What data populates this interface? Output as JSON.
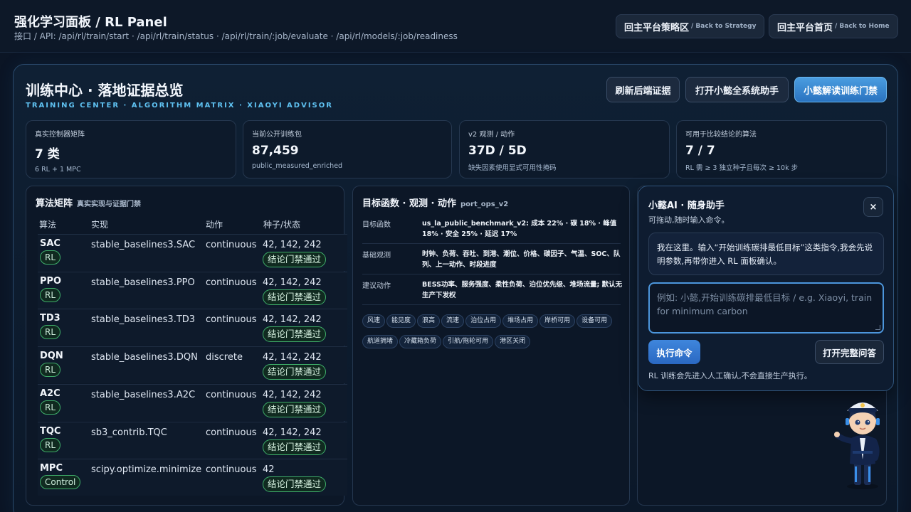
{
  "header": {
    "title": "强化学习面板 / RL Panel",
    "api": "接口 / API: /api/rl/train/start · /api/rl/train/status · /api/rl/train/:job/evaluate · /api/rl/models/:job/readiness",
    "back_strategy": "回主平台策略区",
    "back_strategy_en": "/ Back to Strategy",
    "back_home": "回主平台首页",
    "back_home_en": "/ Back to Home"
  },
  "panel": {
    "title": "训练中心 · 落地证据总览",
    "subtitle": "TRAINING CENTER · ALGORITHM MATRIX · XIAOYI ADVISOR",
    "refresh": "刷新后端证据",
    "open_assistant": "打开小懿全系统助手",
    "interpret": "小懿解读训练门禁"
  },
  "stats": [
    {
      "label": "真实控制器矩阵",
      "value": "7 类",
      "note": "6 RL + 1 MPC"
    },
    {
      "label": "当前公开训练包",
      "value": "87,459",
      "note": "public_measured_enriched"
    },
    {
      "label": "v2 观测 / 动作",
      "value": "37D / 5D",
      "note": "缺失因素使用显式可用性掩码"
    },
    {
      "label": "可用于比较结论的算法",
      "value": "7 / 7",
      "note": "RL 需 ≥ 3 独立种子且每次 ≥ 10k 步"
    }
  ],
  "algorithms": {
    "title": "算法矩阵",
    "subtitle": "真实实现与证据门禁",
    "columns": [
      "算法",
      "实现",
      "动作",
      "种子/状态"
    ],
    "rows": [
      {
        "name": "SAC",
        "tag": "RL",
        "impl": "stable_baselines3.SAC",
        "action": "continuous",
        "seeds": "42, 142, 242",
        "status": "结论门禁通过"
      },
      {
        "name": "PPO",
        "tag": "RL",
        "impl": "stable_baselines3.PPO",
        "action": "continuous",
        "seeds": "42, 142, 242",
        "status": "结论门禁通过"
      },
      {
        "name": "TD3",
        "tag": "RL",
        "impl": "stable_baselines3.TD3",
        "action": "continuous",
        "seeds": "42, 142, 242",
        "status": "结论门禁通过"
      },
      {
        "name": "DQN",
        "tag": "RL",
        "impl": "stable_baselines3.DQN",
        "action": "discrete",
        "seeds": "42, 142, 242",
        "status": "结论门禁通过"
      },
      {
        "name": "A2C",
        "tag": "RL",
        "impl": "stable_baselines3.A2C",
        "action": "continuous",
        "seeds": "42, 142, 242",
        "status": "结论门禁通过"
      },
      {
        "name": "TQC",
        "tag": "RL",
        "impl": "sb3_contrib.TQC",
        "action": "continuous",
        "seeds": "42, 142, 242",
        "status": "结论门禁通过"
      },
      {
        "name": "MPC",
        "tag": "Control",
        "impl": "scipy.optimize.minimize",
        "action": "continuous",
        "seeds": "42",
        "status": "结论门禁通过"
      }
    ]
  },
  "objective": {
    "title": "目标函数 · 观测 · 动作",
    "tag": "port_ops_v2",
    "rows": [
      {
        "key": "目标函数",
        "value": "us_la_public_benchmark_v2: 成本 22% · 碳 18% · 峰值 18% · 安全 25% · 延迟 17%"
      },
      {
        "key": "基础观测",
        "value": "时钟、负荷、吞吐、到港、潮位、价格、碳因子、气温、SOC、队列、上一动作、时段进度"
      },
      {
        "key": "建议动作",
        "value": "BESS功率、服务强度、柔性负荷、泊位优先级、堆场流量; 默认无生产下发权"
      }
    ],
    "chips": [
      "风速",
      "能见度",
      "浪高",
      "流速",
      "泊位占用",
      "堆场占用",
      "岸桥可用",
      "设备可用",
      "航道拥堵",
      "冷藏箱负荷",
      "引航/拖轮可用",
      "港区关闭"
    ]
  },
  "assistant": {
    "title": "小懿AI · 随身助手",
    "subtitle": "可拖动,随时输入命令。",
    "close": "×",
    "message": "我在这里。输入“开始训练碳排最低目标”这类指令,我会先说明参数,再带你进入 RL 面板确认。",
    "placeholder": "例如: 小懿,开始训练碳排最低目标 / e.g. Xiaoyi, train for minimum carbon",
    "run": "执行命令",
    "full": "打开完整问答",
    "footer": "RL 训练会先进入人工确认,不会直接生产执行。"
  }
}
